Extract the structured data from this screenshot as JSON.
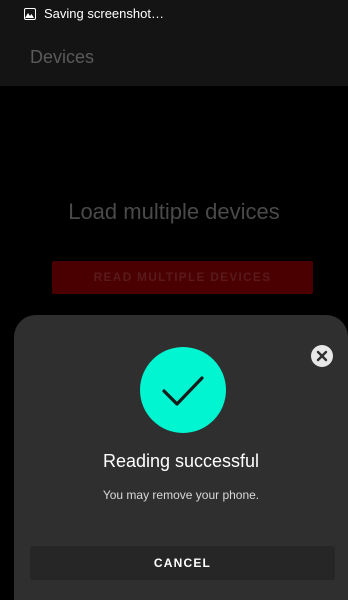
{
  "status_bar": {
    "notification_text": "Saving screenshot…",
    "icon": "screenshot-icon"
  },
  "app_bar": {
    "title": "Devices"
  },
  "main": {
    "heading": "Load multiple devices",
    "read_button_label": "READ MULTIPLE DEVICES"
  },
  "sheet": {
    "title": "Reading successful",
    "subtitle": "You may remove your phone.",
    "cancel_label": "CANCEL",
    "close_icon": "close-icon",
    "success_icon": "checkmark-icon"
  },
  "colors": {
    "success_accent": "#00f5d0",
    "button_dim_red": "#4a0000",
    "sheet_background": "#2f2f2f"
  }
}
